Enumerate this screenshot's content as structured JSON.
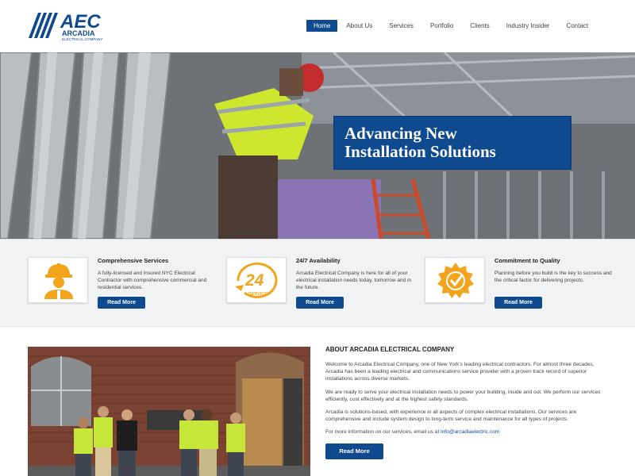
{
  "brand": {
    "logo_main": "AEC",
    "logo_name": "ARCADIA",
    "logo_sub": "ELECTRICAL COMPANY",
    "color": "#0f4a8f"
  },
  "nav": {
    "items": [
      {
        "label": "Home",
        "active": true
      },
      {
        "label": "About Us"
      },
      {
        "label": "Services"
      },
      {
        "label": "Portfolio"
      },
      {
        "label": "Clients"
      },
      {
        "label": "Industry Insider"
      },
      {
        "label": "Contact"
      }
    ]
  },
  "hero": {
    "line1": "Advancing New",
    "line2": "Installation Solutions"
  },
  "features": [
    {
      "icon": "worker-icon",
      "title": "Comprehensive Services",
      "text": "A fully-licensed and insured NYC Electrical Contractor with comprehensive commercial and residential services.",
      "button": "Read More"
    },
    {
      "icon": "24-service-icon",
      "icon_text": "24",
      "icon_sub": "SERVICE",
      "title": "24/7 Availability",
      "text": "Arcadia Electrical Company is here for all of your electrical installation needs today, tomorrow and in the future.",
      "button": "Read More"
    },
    {
      "icon": "quality-badge-icon",
      "title": "Commitment to Quality",
      "text": "Planning before you build is the key to success and the critical factor for delivering projects.",
      "button": "Read More"
    }
  ],
  "about": {
    "title": "ABOUT ARCADIA ELECTRICAL COMPANY",
    "p1": "Welcome to Arcadia Electrical Company, one of New York's leading electrical contractors. For almost three decades, Arcadia has been a leading electrical and communications service provider with a proven track record of superior installations across diverse markets.",
    "p2": "We are ready to serve your electrical installation needs to power your building, inside and out. We perform our services efficiently, cost effectively and at the highest safety standards.",
    "p3": "Arcadia is solutions-based, with experience in all aspects of complex electrical installations. Our services are comprehensive and include system design to long-term service and maintenance for all types of projects.",
    "p4_prefix": "For more information on our services, email us at ",
    "email": "info@arcadiaelectric.com",
    "button": "Read More"
  }
}
